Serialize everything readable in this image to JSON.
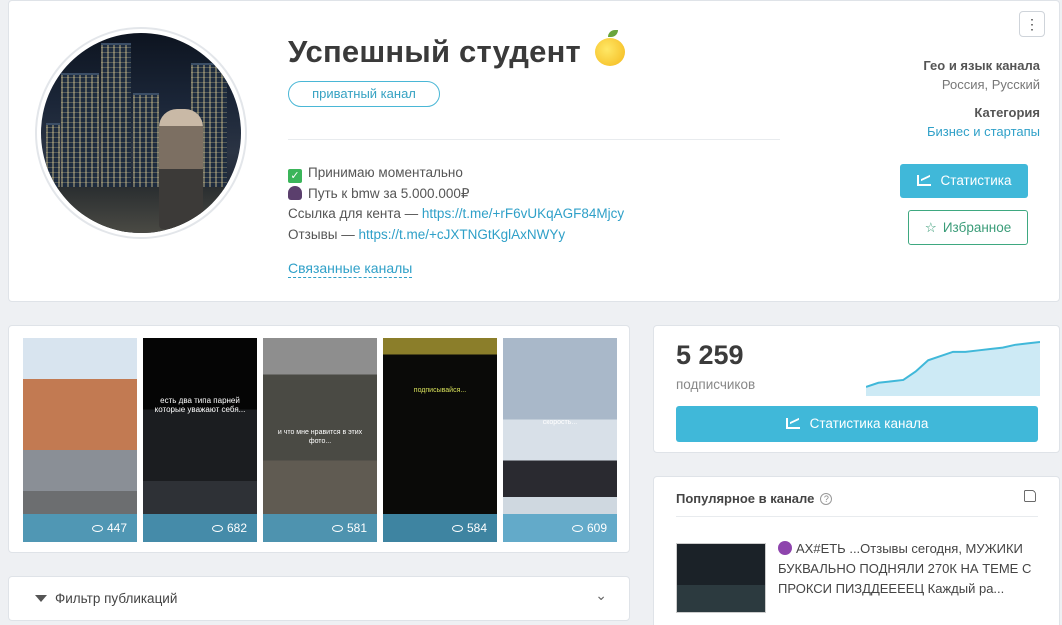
{
  "channel": {
    "title": "Успешный студент",
    "emoji_icon": "lemon-icon",
    "badge": "приватный канал",
    "desc": {
      "line1": "Принимаю моментально",
      "line2": "Путь к bmw за 5.000.000₽",
      "line3_label": "Ссылка для кента — ",
      "line3_link": "https://t.me/+rF6vUKqAGF84Mjcy",
      "line4_label": "Отзывы — ",
      "line4_link": "https://t.me/+cJXTNGtKglAxNWYy"
    },
    "related": "Связанные каналы"
  },
  "side": {
    "geo_heading": "Гео и язык канала",
    "geo_value": "Россия, Русский",
    "category_heading": "Категория",
    "category_value": "Бизнес и стартапы",
    "stats_button": "Статистика",
    "favorite_button": "Избранное",
    "menu_icon": "⋮"
  },
  "stories": [
    {
      "views": "447"
    },
    {
      "views": "682",
      "text": "есть два типа парней которые уважают себя..."
    },
    {
      "views": "581",
      "text": "и что мне нравится в этих фото..."
    },
    {
      "views": "584",
      "text": "подписывайся..."
    },
    {
      "views": "609",
      "text": "скорость..."
    }
  ],
  "filter": {
    "label": "Фильтр публикаций"
  },
  "subscribers": {
    "count": "5 259",
    "label": "подписчиков",
    "button": "Статистика канала",
    "trend": [
      5,
      8,
      9,
      10,
      16,
      24,
      27,
      30,
      30,
      31,
      32,
      33,
      35,
      36,
      37
    ]
  },
  "popular": {
    "heading": "Популярное в канале",
    "post_text": "АХ#ЕТЬ ...Отзывы сегодня, МУЖИКИ БУКВАЛЬНО ПОДНЯЛИ 270К НА ТЕМЕ С ПРОКСИ ПИЗДДЕЕЕЕЦ Каждый ра..."
  },
  "colors": {
    "accent": "#40b8d9",
    "favorite": "#3ea880",
    "link": "#2fa0c8"
  }
}
